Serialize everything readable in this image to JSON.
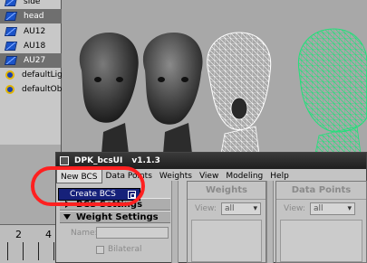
{
  "outliner": {
    "items": [
      {
        "label": "side",
        "icon": "camera-icon",
        "selected": false
      },
      {
        "label": "head",
        "icon": "camera-icon",
        "selected": true
      },
      {
        "label": "AU12",
        "icon": "mesh-icon",
        "selected": false
      },
      {
        "label": "AU18",
        "icon": "mesh-icon",
        "selected": false
      },
      {
        "label": "AU27",
        "icon": "mesh-icon",
        "selected": true
      },
      {
        "label": "defaultLigl",
        "icon": "set-icon",
        "selected": false
      },
      {
        "label": "defaultObj",
        "icon": "set-icon",
        "selected": false
      }
    ]
  },
  "timeline": {
    "frame_a": "2",
    "frame_b": "4"
  },
  "window": {
    "title": "DPK_bcsUI",
    "version": "v1.1.3"
  },
  "menubar": {
    "items": [
      "New BCS",
      "Data Points",
      "Weights",
      "View",
      "Modeling",
      "Help"
    ]
  },
  "dropdown": {
    "item": "Create BCS",
    "option_icon": "option-box-icon"
  },
  "settings": {
    "bcs_section": "BCS Settings",
    "weight_section": "Weight Settings",
    "name_label": "Name:",
    "bilateral_label": "Bilateral"
  },
  "weights_panel": {
    "title": "Weights",
    "view_label": "View:",
    "view_value": "all"
  },
  "datapoints_panel": {
    "title": "Data Points",
    "view_label": "View:",
    "view_value": "all"
  },
  "colors": {
    "highlight": "#ff2020",
    "menu_active": "#16217a",
    "selected_row": "#6f6f6f",
    "wire_green": "#22e07a",
    "wire_white": "#ffffff"
  }
}
